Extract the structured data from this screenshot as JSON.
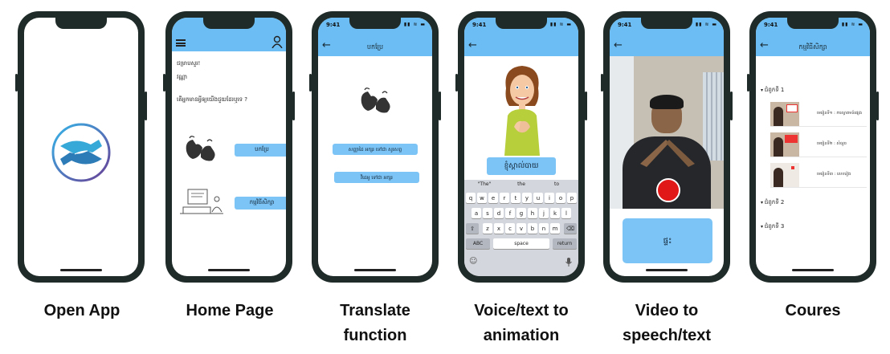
{
  "captions": [
    "Open App",
    "Home Page",
    "Translate function",
    "Voice/text to animation",
    "Video to speech/text",
    "Coures"
  ],
  "status": {
    "time": "9:41",
    "icons": "▮▮ ≋ ▬"
  },
  "colors": {
    "accent": "#6bbdf3",
    "frame": "#1f2b28",
    "record": "#e01818"
  },
  "home": {
    "greeting": "ជម្រាបសួរ!",
    "name": "វណ្ណា",
    "question": "តើអ្នកមានអ្វីឲ្យយើងជួយដែរឬទេ ?",
    "translate_label": "បកប្រែ",
    "course_label": "កម្មវិធីសិក្សា"
  },
  "translate": {
    "title": "បកប្រែ",
    "option1": "សញ្ញាដៃ អក្សរ ទៅជា សូរសព្ទ",
    "option2": "វីដេអូ ទៅជា អក្សរ"
  },
  "voice": {
    "word": "ខ្ញុំស្គាល់បាយ",
    "suggestions": [
      "\"The\"",
      "the",
      "to"
    ],
    "row1": [
      "q",
      "w",
      "e",
      "r",
      "t",
      "y",
      "u",
      "i",
      "o",
      "p"
    ],
    "row2": [
      "a",
      "s",
      "d",
      "f",
      "g",
      "h",
      "j",
      "k",
      "l"
    ],
    "row3": [
      "z",
      "x",
      "c",
      "v",
      "b",
      "n",
      "m"
    ],
    "abc": "ABC",
    "space": "space",
    "return": "return"
  },
  "video": {
    "result": "ផ្ទះ"
  },
  "course": {
    "title": "កម្មវិធីសិក្សា",
    "chapter1": "ជំពូកទី 1",
    "chapter2": "ជំពូកទី 2",
    "chapter3": "ជំពូកទី 3",
    "lessons": [
      "មេរៀនទី១ : ការស្វាគមន៍ផ្សេង",
      "មេរៀនទី២ : សំណួរ",
      "មេរៀនទី៣ : លេខរៀង"
    ]
  }
}
